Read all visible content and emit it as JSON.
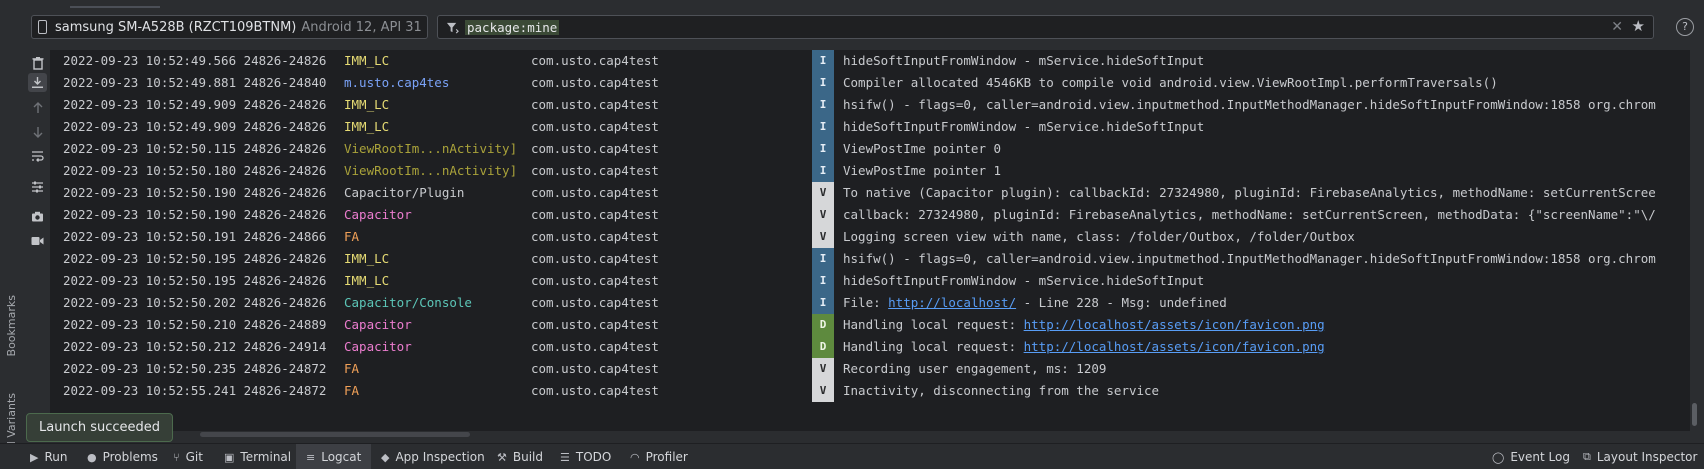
{
  "device": {
    "name": "samsung SM-A528B (RZCT109BTNM)",
    "api": "Android 12, API 31"
  },
  "filter": {
    "value": "package:mine",
    "clear_glyph": "✕",
    "star_glyph": "★"
  },
  "help_glyph": "?",
  "side_labels": {
    "bookmarks": "Bookmarks",
    "build_variants": "Build Variants"
  },
  "icons": {
    "trash": "trash-icon",
    "scroll_end": "scroll-to-end-icon",
    "up": "arrow-up-icon",
    "down": "arrow-down-icon",
    "wrap": "soft-wrap-icon",
    "settings": "format-settings-icon",
    "camera": "screenshot-icon",
    "record": "screen-record-icon"
  },
  "colors": {
    "tag_imm": "#e6db74",
    "tag_cap_blue": "#7aa2f7",
    "tag_viewroot": "#a9a23a",
    "tag_plain": "#c8cace",
    "tag_pink": "#ec7dcf",
    "tag_fa": "#f0a058",
    "tag_teal": "#5cc6b8",
    "level_info": "#3b6788",
    "level_verbose": "#d6d7d9",
    "level_debug": "#5e8a3e",
    "link": "#589df6"
  },
  "logs": [
    {
      "dt": "2022-09-23 10:52:49.566 24826-24826",
      "tag": "IMM_LC",
      "tc": "#e6db74",
      "pkg": "com.usto.cap4test",
      "lvl": "I",
      "msg": "hideSoftInputFromWindow - mService.hideSoftInput"
    },
    {
      "dt": "2022-09-23 10:52:49.881 24826-24840",
      "tag": "m.usto.cap4tes",
      "tc": "#7aa2f7",
      "pkg": "com.usto.cap4test",
      "lvl": "I",
      "msg": "Compiler allocated 4546KB to compile void android.view.ViewRootImpl.performTraversals()"
    },
    {
      "dt": "2022-09-23 10:52:49.909 24826-24826",
      "tag": "IMM_LC",
      "tc": "#e6db74",
      "pkg": "com.usto.cap4test",
      "lvl": "I",
      "msg": "hsifw() - flags=0, caller=android.view.inputmethod.InputMethodManager.hideSoftInputFromWindow:1858 org.chrom"
    },
    {
      "dt": "2022-09-23 10:52:49.909 24826-24826",
      "tag": "IMM_LC",
      "tc": "#e6db74",
      "pkg": "com.usto.cap4test",
      "lvl": "I",
      "msg": "hideSoftInputFromWindow - mService.hideSoftInput"
    },
    {
      "dt": "2022-09-23 10:52:50.115 24826-24826",
      "tag": "ViewRootIm...nActivity]",
      "tc": "#a9a23a",
      "pkg": "com.usto.cap4test",
      "lvl": "I",
      "msg": "ViewPostIme pointer 0"
    },
    {
      "dt": "2022-09-23 10:52:50.180 24826-24826",
      "tag": "ViewRootIm...nActivity]",
      "tc": "#a9a23a",
      "pkg": "com.usto.cap4test",
      "lvl": "I",
      "msg": "ViewPostIme pointer 1"
    },
    {
      "dt": "2022-09-23 10:52:50.190 24826-24826",
      "tag": "Capacitor/Plugin",
      "tc": "#c8cace",
      "pkg": "com.usto.cap4test",
      "lvl": "V",
      "msg": "To native (Capacitor plugin): callbackId: 27324980, pluginId: FirebaseAnalytics, methodName: setCurrentScree"
    },
    {
      "dt": "2022-09-23 10:52:50.190 24826-24826",
      "tag": "Capacitor",
      "tc": "#ec7dcf",
      "pkg": "com.usto.cap4test",
      "lvl": "V",
      "msg": "callback: 27324980, pluginId: FirebaseAnalytics, methodName: setCurrentScreen, methodData: {\"screenName\":\"\\/"
    },
    {
      "dt": "2022-09-23 10:52:50.191 24826-24866",
      "tag": "FA",
      "tc": "#f0a058",
      "pkg": "com.usto.cap4test",
      "lvl": "V",
      "msg": "Logging screen view with name, class: /folder/Outbox, /folder/Outbox"
    },
    {
      "dt": "2022-09-23 10:52:50.195 24826-24826",
      "tag": "IMM_LC",
      "tc": "#e6db74",
      "pkg": "com.usto.cap4test",
      "lvl": "I",
      "msg": "hsifw() - flags=0, caller=android.view.inputmethod.InputMethodManager.hideSoftInputFromWindow:1858 org.chrom"
    },
    {
      "dt": "2022-09-23 10:52:50.195 24826-24826",
      "tag": "IMM_LC",
      "tc": "#e6db74",
      "pkg": "com.usto.cap4test",
      "lvl": "I",
      "msg": "hideSoftInputFromWindow - mService.hideSoftInput"
    },
    {
      "dt": "2022-09-23 10:52:50.202 24826-24826",
      "tag": "Capacitor/Console",
      "tc": "#5cc6b8",
      "pkg": "com.usto.cap4test",
      "lvl": "I",
      "msg_pre": "File: ",
      "link": "http://localhost/",
      "msg_post": " - Line 228 - Msg: undefined"
    },
    {
      "dt": "2022-09-23 10:52:50.210 24826-24889",
      "tag": "Capacitor",
      "tc": "#ec7dcf",
      "pkg": "com.usto.cap4test",
      "lvl": "D",
      "msg_pre": "Handling local request: ",
      "link": "http://localhost/assets/icon/favicon.png",
      "msg_post": ""
    },
    {
      "dt": "2022-09-23 10:52:50.212 24826-24914",
      "tag": "Capacitor",
      "tc": "#ec7dcf",
      "pkg": "com.usto.cap4test",
      "lvl": "D",
      "msg_pre": "Handling local request: ",
      "link": "http://localhost/assets/icon/favicon.png",
      "msg_post": ""
    },
    {
      "dt": "2022-09-23 10:52:50.235 24826-24872",
      "tag": "FA",
      "tc": "#f0a058",
      "pkg": "com.usto.cap4test",
      "lvl": "V",
      "msg": "Recording user engagement, ms: 1209"
    },
    {
      "dt": "2022-09-23 10:52:55.241 24826-24872",
      "tag": "FA",
      "tc": "#f0a058",
      "pkg": "com.usto.cap4test",
      "lvl": "V",
      "msg": "Inactivity, disconnecting from the service"
    }
  ],
  "toast": "Launch succeeded",
  "bottom_tabs": [
    {
      "label": "Run",
      "glyph": "▶",
      "icon": "run-icon"
    },
    {
      "label": "Problems",
      "glyph": "●",
      "icon": "problems-icon"
    },
    {
      "label": "Git",
      "glyph": "⑂",
      "icon": "git-icon"
    },
    {
      "label": "Terminal",
      "glyph": "▣",
      "icon": "terminal-icon"
    },
    {
      "label": "Logcat",
      "glyph": "≡",
      "icon": "logcat-icon"
    },
    {
      "label": "App Inspection",
      "glyph": "◆",
      "icon": "app-inspection-icon"
    },
    {
      "label": "Build",
      "glyph": "⚒",
      "icon": "build-icon"
    },
    {
      "label": "TODO",
      "glyph": "☰",
      "icon": "todo-icon"
    },
    {
      "label": "Profiler",
      "glyph": "◠",
      "icon": "profiler-icon"
    }
  ],
  "right_tabs": [
    {
      "label": "Event Log",
      "glyph": "◯",
      "icon": "event-log-icon"
    },
    {
      "label": "Layout Inspector",
      "glyph": "⧉",
      "icon": "layout-inspector-icon"
    }
  ]
}
